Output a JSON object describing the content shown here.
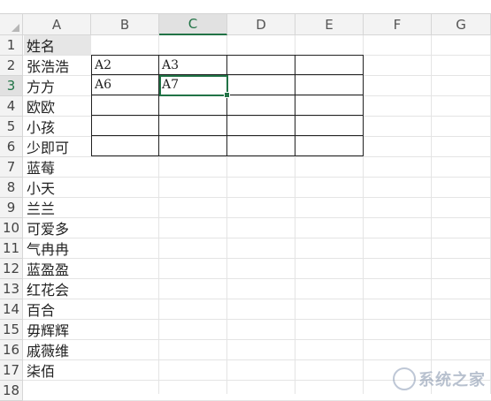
{
  "columns": [
    "A",
    "B",
    "C",
    "D",
    "E",
    "F",
    "G"
  ],
  "active_column": "C",
  "rows": [
    "1",
    "2",
    "3",
    "4",
    "5",
    "6",
    "7",
    "8",
    "9",
    "10",
    "11",
    "12",
    "13",
    "14",
    "15",
    "16",
    "17",
    "18"
  ],
  "active_row": "3",
  "column_a": [
    "姓名",
    "张浩浩",
    "方方",
    "欧欧",
    "小孩",
    "少即可",
    "蓝莓",
    "小天",
    "兰兰",
    "可爱多",
    "气冉冉",
    "蓝盈盈",
    "红花会",
    "百合",
    "毋辉辉",
    "戚薇维",
    "柒佰"
  ],
  "table": [
    [
      "A2",
      "A3",
      "",
      ""
    ],
    [
      "A6",
      "A7",
      "",
      ""
    ],
    [
      "",
      "",
      "",
      ""
    ],
    [
      "",
      "",
      "",
      ""
    ],
    [
      "",
      "",
      "",
      ""
    ]
  ],
  "watermark": {
    "text": "系统之家"
  },
  "colors": {
    "accent": "#217346",
    "header_bg": "#f3f3f3",
    "table_border": "#222222"
  }
}
